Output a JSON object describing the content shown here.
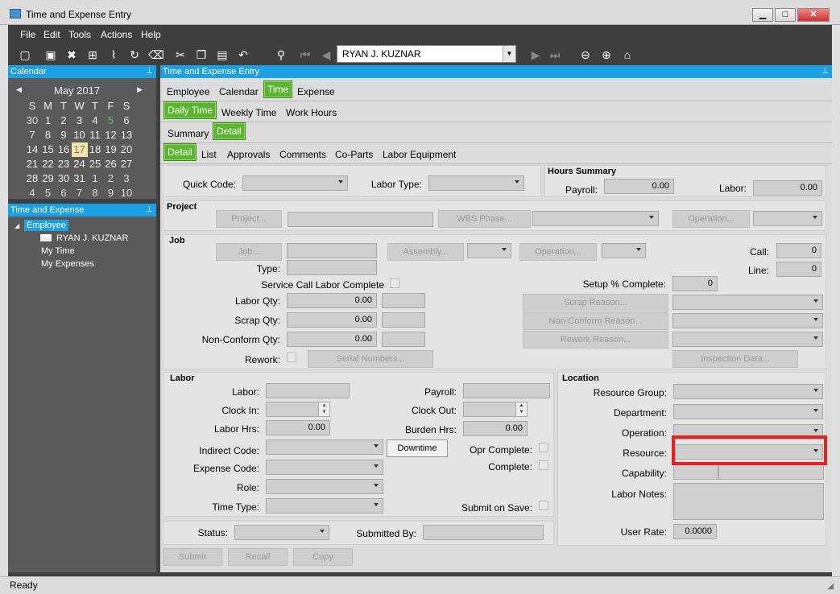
{
  "window": {
    "title": "Time and Expense Entry",
    "minimize": "▁",
    "maximize": "□",
    "close": "✕"
  },
  "menu": [
    "File",
    "Edit",
    "Tools",
    "Actions",
    "Help"
  ],
  "toolbar": {
    "employee_value": "RYAN J. KUZNAR"
  },
  "calendar": {
    "panel_title": "Calendar",
    "month": "May 2017",
    "weekdays": [
      "S",
      "M",
      "T",
      "W",
      "T",
      "F",
      "S"
    ],
    "weeks": [
      [
        "30",
        "1",
        "2",
        "3",
        "4",
        "5",
        "6"
      ],
      [
        "7",
        "8",
        "9",
        "10",
        "11",
        "12",
        "13"
      ],
      [
        "14",
        "15",
        "16",
        "17",
        "18",
        "19",
        "20"
      ],
      [
        "21",
        "22",
        "23",
        "24",
        "25",
        "26",
        "27"
      ],
      [
        "28",
        "29",
        "30",
        "31",
        "1",
        "2",
        "3"
      ],
      [
        "4",
        "5",
        "6",
        "7",
        "8",
        "9",
        "10"
      ]
    ],
    "today": "17"
  },
  "tree": {
    "panel_title": "Time and Expense",
    "root": "Employee",
    "employee": "RYAN J. KUZNAR",
    "items": [
      "My Time",
      "My Expenses"
    ]
  },
  "main": {
    "panel_title": "Time and Expense Entry",
    "tabs1": [
      "Employee",
      "Calendar",
      "Time",
      "Expense"
    ],
    "tabs2": [
      "Daily Time",
      "Weekly Time",
      "Work Hours"
    ],
    "tabs3": [
      "Summary",
      "Detail"
    ],
    "tabs4": [
      "Detail",
      "List",
      "Approvals",
      "Comments",
      "Co-Parts",
      "Labor Equipment"
    ]
  },
  "top": {
    "quick_code": "Quick Code:",
    "labor_type": "Labor Type:",
    "hours_summary": "Hours Summary",
    "payroll": "Payroll:",
    "payroll_value": "0.00",
    "labor": "Labor:",
    "labor_value": "0.00"
  },
  "project": {
    "title": "Project",
    "project_btn": "Project...",
    "wbs_btn": "WBS Phase...",
    "operation_btn": "Operation..."
  },
  "job": {
    "title": "Job",
    "job_btn": "Job...",
    "assembly_btn": "Assembly...",
    "operation_btn": "Operation...",
    "call": "Call:",
    "call_value": "0",
    "line": "Line:",
    "line_value": "0",
    "type": "Type:",
    "service_call": "Service Call Labor Complete",
    "setup": "Setup % Complete:",
    "setup_value": "0",
    "labor_qty": "Labor Qty:",
    "labor_qty_value": "0.00",
    "scrap_qty": "Scrap Qty:",
    "scrap_qty_value": "0.00",
    "nonconform_qty": "Non-Conform Qty:",
    "nonconform_qty_value": "0.00",
    "scrap_reason_btn": "Scrap Reason...",
    "nonconform_reason_btn": "Non-Conform Reason...",
    "rework_reason_btn": "Rework Reason...",
    "rework": "Rework:",
    "serial_btn": "Serial Numbers...",
    "inspection_btn": "Inspection Data..."
  },
  "labor": {
    "title": "Labor",
    "labor": "Labor:",
    "clock_in": "Clock In:",
    "labor_hrs": "Labor Hrs:",
    "labor_hrs_value": "0.00",
    "indirect_code": "Indirect Code:",
    "expense_code": "Expense Code:",
    "role": "Role:",
    "time_type": "Time Type:",
    "payroll": "Payroll:",
    "clock_out": "Clock Out:",
    "burden_hrs": "Burden Hrs:",
    "burden_hrs_value": "0.00",
    "downtime_btn": "Downtime",
    "opr_complete": "Opr Complete:",
    "complete": "Complete:",
    "submit_on_save": "Submit on Save:"
  },
  "location": {
    "title": "Location",
    "resource_group": "Resource Group:",
    "department": "Department:",
    "operation": "Operation:",
    "resource": "Resource:",
    "capability": "Capability:",
    "labor_notes": "Labor Notes:",
    "user_rate": "User Rate:",
    "user_rate_value": "0.0000"
  },
  "bottom": {
    "status": "Status:",
    "submitted_by": "Submitted By:",
    "submit_btn": "Submit",
    "recall_btn": "Recall",
    "copy_btn": "Copy"
  },
  "statusbar": {
    "text": "Ready"
  },
  "colors": {
    "accent_green": "#5cb531",
    "panel_blue": "#1aa0e3",
    "highlight_red": "#e42424"
  }
}
